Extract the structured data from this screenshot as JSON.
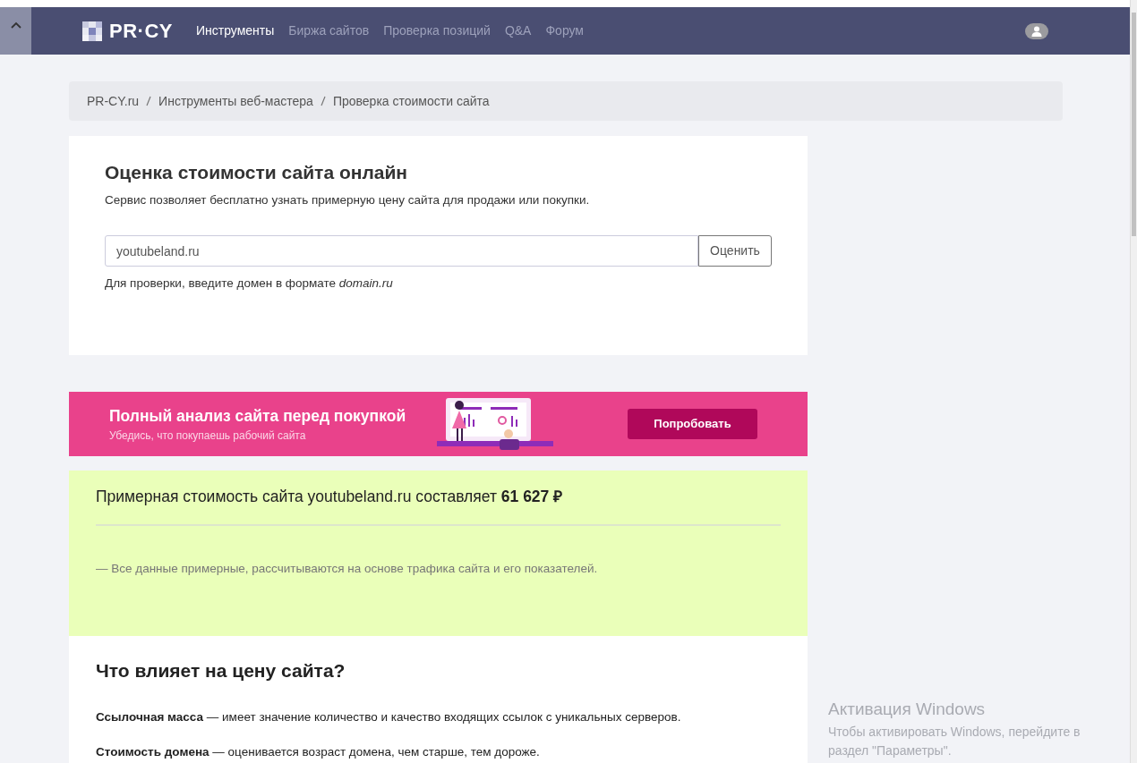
{
  "navbar": {
    "logo": "PR·CY",
    "links": [
      {
        "label": "Инструменты",
        "selected": true
      },
      {
        "label": "Биржа сайтов",
        "selected": false
      },
      {
        "label": "Проверка позиций",
        "selected": false
      },
      {
        "label": "Q&A",
        "selected": false
      },
      {
        "label": "Форум",
        "selected": false
      }
    ]
  },
  "breadcrumb": [
    "PR-CY.ru",
    "Инструменты веб-мастера",
    "Проверка стоимости сайта"
  ],
  "estimator": {
    "title": "Оценка стоимости сайта онлайн",
    "description": "Сервис позволяет бесплатно узнать примерную цену сайта для продажи или покупки.",
    "input_value": "youtubeland.ru",
    "button": "Оценить",
    "hint": "Для проверки, введите домен в формате *domain.ru*"
  },
  "promo_banner": {
    "title": "Полный анализ сайта перед покупкой",
    "subtitle": "Убедись, что покупаешь рабочий сайта",
    "button": "Попробовать"
  },
  "result": {
    "text": "Примерная стоимость сайта youtubeland.ru составляет **61 627 ₽**",
    "note": "— Все данные примерные, рассчитываются на основе трафика сайта и его показателей."
  },
  "factors": {
    "title": "Что влияет на цену сайта?",
    "items": [
      "**Ссылочная масса** — имеет значение количество и качество входящих ссылок с уникальных серверов.",
      "**Стоимость домена** — оценивается возраст домена, чем старше, тем дороже."
    ]
  },
  "os_notice": {
    "title": "Активация Windows",
    "text": "Чтобы активировать Windows, перейдите в раздел \"Параметры\"."
  }
}
